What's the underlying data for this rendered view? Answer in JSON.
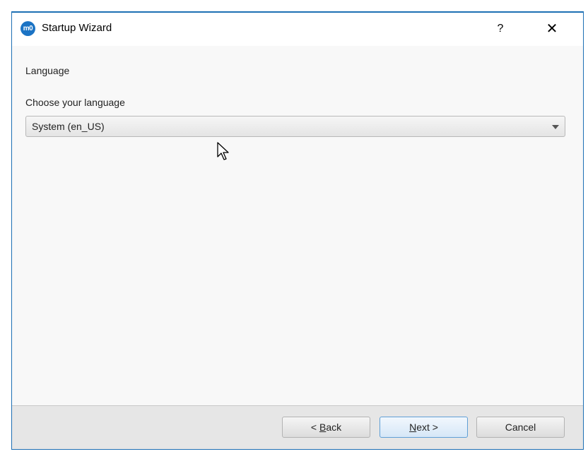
{
  "window": {
    "title": "Startup Wizard",
    "logo_text": "m0",
    "help_label": "?",
    "close_label": "✕"
  },
  "page": {
    "section_title": "Language",
    "language_label": "Choose your language",
    "language_select": {
      "selected": "System (en_US)"
    }
  },
  "buttons": {
    "back": {
      "prefix": "< ",
      "mnemonic": "B",
      "rest": "ack"
    },
    "next": {
      "prefix": "",
      "mnemonic": "N",
      "rest": "ext >"
    },
    "cancel": "Cancel"
  },
  "colors": {
    "title_border": "#1d6fb4",
    "logo": "#1b73c4",
    "default_button_border": "#5f9fd6"
  }
}
